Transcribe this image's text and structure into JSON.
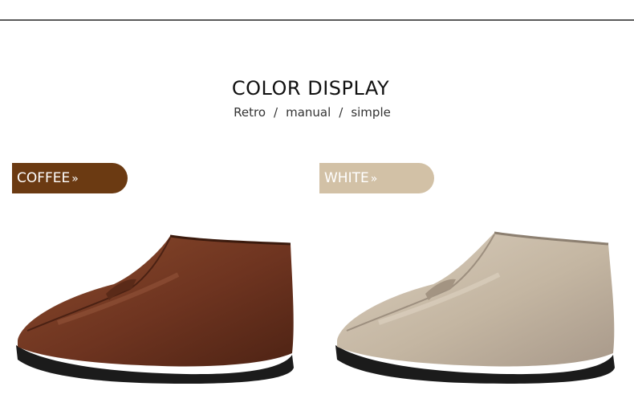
{
  "header": {
    "title": "COLOR DISPLAY",
    "subtitle": {
      "word1": "Retro",
      "word2": "manual",
      "word3": "simple",
      "separator": "/"
    }
  },
  "variants": [
    {
      "label": "COFFEE",
      "chevron": "»",
      "tag_color": "#6b3a12",
      "leather_color": "#7a3a20"
    },
    {
      "label": "WHITE",
      "chevron": "»",
      "tag_color": "#d2c1a6",
      "leather_color": "#c6b8a4"
    }
  ],
  "colors": {
    "rule": "#5a5a5a",
    "sole": "#1b1b1b"
  }
}
